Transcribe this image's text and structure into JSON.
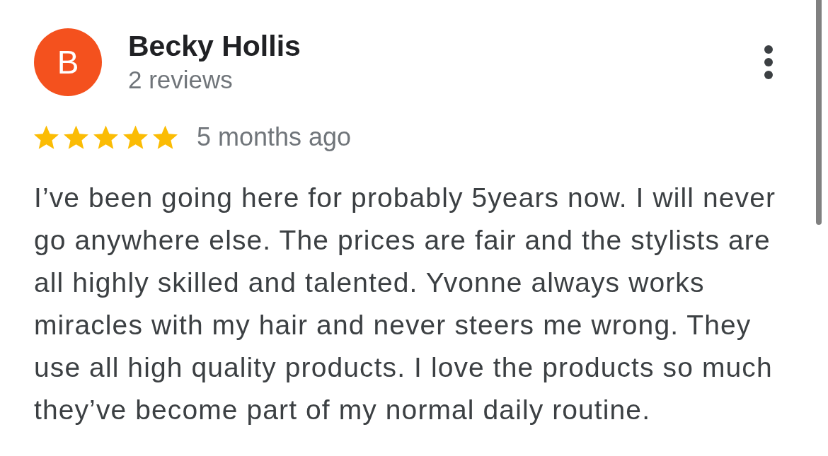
{
  "review": {
    "author": {
      "initial": "B",
      "name": "Becky Hollis",
      "review_count": "2 reviews"
    },
    "stars": 5,
    "time": "5 months ago",
    "text": "I’ve been going here for probably 5years now. I will never go anywhere else. The prices are fair and the stylists are all highly skilled and talented. Yvonne always works miracles with my hair and never steers me wrong. They use all high quality products. I love the products so much they’ve become part of my normal daily routine."
  }
}
